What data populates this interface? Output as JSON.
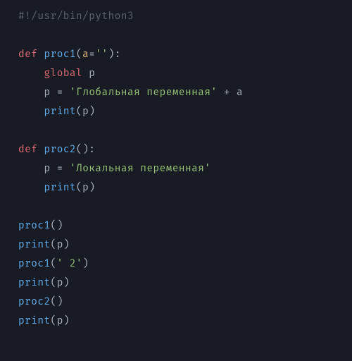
{
  "code": {
    "line1": {
      "shebang": "#!/usr/bin/python3"
    },
    "line2": "",
    "line3": {
      "def": "def ",
      "name": "proc1",
      "lp": "(",
      "param": "a",
      "eq": "=",
      "default": "''",
      "rp": "):"
    },
    "line4": {
      "indent": "    ",
      "global": "global ",
      "var": "p"
    },
    "line5": {
      "indent": "    ",
      "var": "p",
      "sp": " ",
      "eq": "=",
      "sp2": " ",
      "str": "'Глобальная переменная'",
      "sp3": " ",
      "plus": "+",
      "sp4": " ",
      "arg": "a"
    },
    "line6": {
      "indent": "    ",
      "print": "print",
      "lp": "(",
      "var": "p",
      "rp": ")"
    },
    "line7": "",
    "line8": {
      "def": "def ",
      "name": "proc2",
      "lp": "(",
      "rp": "):"
    },
    "line9": {
      "indent": "    ",
      "var": "p",
      "sp": " ",
      "eq": "=",
      "sp2": " ",
      "str": "'Локальная переменная'"
    },
    "line10": {
      "indent": "    ",
      "print": "print",
      "lp": "(",
      "var": "p",
      "rp": ")"
    },
    "line11": "",
    "line12": {
      "call": "proc1",
      "lp": "(",
      "rp": ")"
    },
    "line13": {
      "print": "print",
      "lp": "(",
      "var": "p",
      "rp": ")"
    },
    "line14": {
      "call": "proc1",
      "lp": "(",
      "str": "' 2'",
      "rp": ")"
    },
    "line15": {
      "print": "print",
      "lp": "(",
      "var": "p",
      "rp": ")"
    },
    "line16": {
      "call": "proc2",
      "lp": "(",
      "rp": ")"
    },
    "line17": {
      "print": "print",
      "lp": "(",
      "var": "p",
      "rp": ")"
    }
  }
}
